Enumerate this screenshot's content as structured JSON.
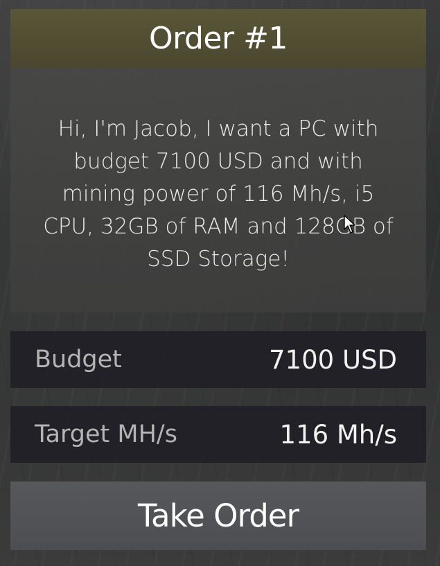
{
  "order": {
    "title": "Order #1",
    "message": "Hi, I'm Jacob, I want a PC with budget 7100 USD and with mining power of 116 Mh/s, i5 CPU, 32GB of RAM and 128GB of SSD Storage!",
    "budget": {
      "label": "Budget",
      "value": "7100 USD"
    },
    "target": {
      "label": "Target MH/s",
      "value": "116 Mh/s"
    },
    "action_label": "Take Order"
  },
  "colors": {
    "header": "#524f34",
    "row": "#212026",
    "button": "#535458"
  },
  "icons": [
    "mouse-cursor-icon"
  ]
}
